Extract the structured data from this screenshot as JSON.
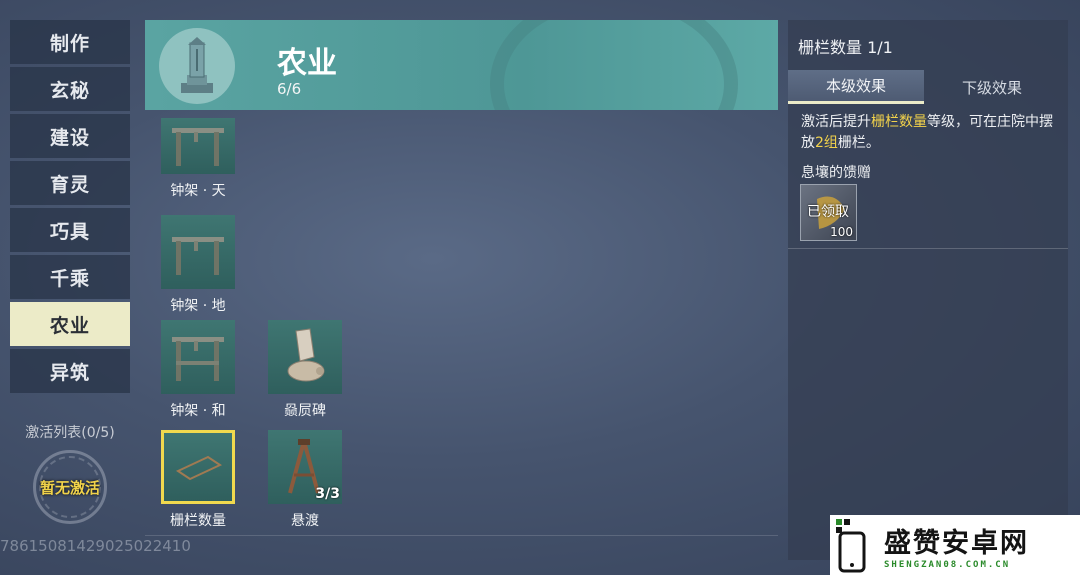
{
  "nav": {
    "items": [
      {
        "label": "制作"
      },
      {
        "label": "玄秘"
      },
      {
        "label": "建设"
      },
      {
        "label": "育灵"
      },
      {
        "label": "巧具"
      },
      {
        "label": "千乘"
      },
      {
        "label": "农业",
        "active": true
      },
      {
        "label": "异筑"
      }
    ],
    "activation_list_label": "激活列表(0/5)",
    "activation_status": "暂无激活"
  },
  "banner": {
    "title": "农业",
    "count": "6/6"
  },
  "items": [
    {
      "name": "钟架 · 天"
    },
    {
      "name": "钟架 · 地"
    },
    {
      "name": "钟架 · 和"
    },
    {
      "name": "赑屃碑"
    },
    {
      "name": "栅栏数量",
      "selected": true
    },
    {
      "name": "悬渡",
      "badge": "3/3"
    }
  ],
  "uid": "78615081429025022410",
  "detail": {
    "title": "栅栏数量 1/1",
    "tabs": [
      "本级效果",
      "下级效果"
    ],
    "desc_part1": "激活后提升",
    "desc_hl1": "栅栏数量",
    "desc_part2": "等级，可在庄院中摆放",
    "desc_hl2": "2组",
    "desc_part3": "栅栏。",
    "reward_title": "息壤的馈赠",
    "reward_status": "已领取",
    "reward_qty": "100"
  },
  "watermark": {
    "name": "盛赞安卓网",
    "url": "SHENGZAN08.COM.CN"
  },
  "colors": {
    "accent_yellow": "#f2d24b",
    "banner_teal": "#5aa4a2",
    "active_nav": "#ecebc8"
  }
}
